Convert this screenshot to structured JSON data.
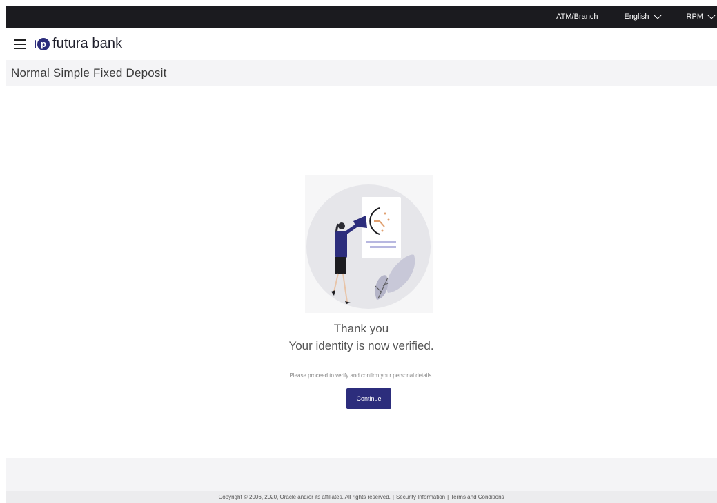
{
  "topbar": {
    "atm_branch": "ATM/Branch",
    "language": "English",
    "user": "RPM"
  },
  "brand": {
    "logo_letter": "p",
    "name": "futura bank"
  },
  "page": {
    "title": "Normal Simple Fixed Deposit"
  },
  "confirmation": {
    "heading": "Thank you",
    "subheading": "Your identity is now verified.",
    "instruction": "Please proceed to verify and confirm your personal details.",
    "continue_label": "Continue"
  },
  "footer": {
    "copyright": "Copyright © 2006, 2020, Oracle and/or its affiliates. All rights reserved.",
    "security_link": "Security Information",
    "terms_link": "Terms and Conditions",
    "separator": "|"
  },
  "colors": {
    "topbar_bg": "#1b1b1f",
    "brand_primary": "#2c2d7c",
    "page_band": "#f4f4f6"
  },
  "icons": {
    "menu": "hamburger-menu-icon",
    "dropdown": "chevron-down-icon",
    "logo": "futura-bank-logo"
  }
}
